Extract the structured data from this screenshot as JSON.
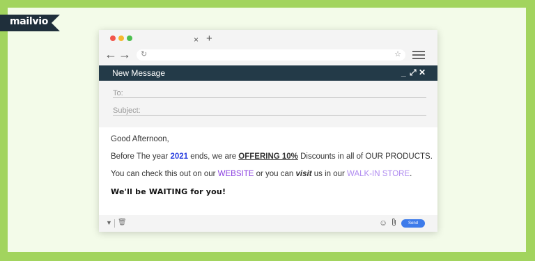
{
  "brand": {
    "logo_text": "mailvio"
  },
  "browser": {
    "tab_close_icon": "close-icon",
    "new_tab_symbol": "+",
    "back_symbol": "←",
    "forward_symbol": "→",
    "reload_symbol": "↻",
    "bookmark_symbol": "☆"
  },
  "compose": {
    "title": "New Message",
    "controls": {
      "minimize": "_",
      "maximize": "⤢",
      "close": "✕"
    },
    "to_placeholder": "To:",
    "subject_placeholder": "Subject:",
    "body": {
      "greeting": "Good Afternoon,",
      "line2": {
        "part1": "Before The year ",
        "year": "2021",
        "part2": " ends, we are ",
        "offer": "OFFERING 10%",
        "part3": " Discounts in all of OUR PRODUCTS."
      },
      "line3": {
        "part1": "You can check this out on our ",
        "website": "WEBSITE",
        "part2": " or you can ",
        "visit": "visit",
        "part3": " us in our ",
        "store": "WALK-IN STORE",
        "part4": "."
      },
      "closing": "We'll be WAITING for you!"
    },
    "footer": {
      "send_label": "Send",
      "emoji_symbol": "☺",
      "attach_symbol": "⌀"
    }
  },
  "colors": {
    "accent_green": "#a2d45e",
    "title_bar": "#233a48",
    "send_blue": "#3d7bea",
    "year_blue": "#2a3fe0",
    "link_purple": "#8a3ee0",
    "store_lavender": "#b08cf0"
  }
}
